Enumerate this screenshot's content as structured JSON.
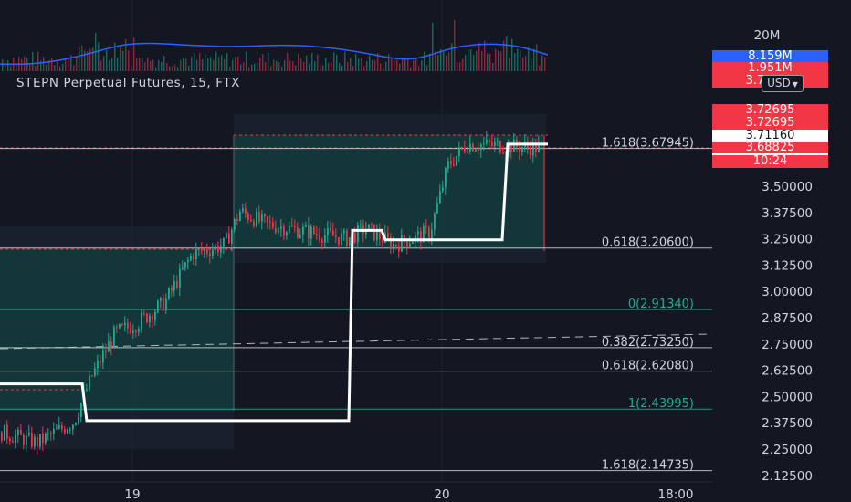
{
  "symbol_title": "STEPN Perpetual Futures, 15, FTX",
  "currency_button": "USD",
  "volume_axis_label": "20M",
  "price_tags": [
    {
      "text": "8.159M",
      "bg": "#2962ff",
      "fg": "#ffffff"
    },
    {
      "text": "1.951M",
      "bg": "#f23645",
      "fg": "#ffffff"
    },
    {
      "text": "3.72695",
      "bg": "#f23645",
      "fg": "#ffffff"
    },
    {
      "text": "3.72695",
      "bg": "#f23645",
      "fg": "#ffffff"
    },
    {
      "text": "3.72695",
      "bg": "#f23645",
      "fg": "#ffffff"
    },
    {
      "text": "3.71160",
      "bg": "#ffffff",
      "fg": "#131722"
    },
    {
      "text": "3.68825",
      "bg": "#ffffff",
      "fg": "#131722"
    },
    {
      "text": "3.68825",
      "bg": "#f23645",
      "fg": "#ffffff"
    },
    {
      "text": "10:24",
      "bg": "#f23645",
      "fg": "#ffffff"
    }
  ],
  "chart_data": {
    "type": "candlestick",
    "symbol": "STEPN Perpetual Futures",
    "interval": "15",
    "exchange": "FTX",
    "y_axis_labels": [
      "3.50000",
      "3.37500",
      "3.25000",
      "3.12500",
      "3.00000",
      "2.87500",
      "2.75000",
      "2.62500",
      "2.50000",
      "2.37500",
      "2.25000",
      "2.12500"
    ],
    "x_axis_labels": [
      "19",
      "20",
      "18:00"
    ],
    "ylim": [
      2.1,
      3.8
    ],
    "fib_levels": [
      {
        "label": "1.618(3.67945)",
        "value": 3.67945,
        "color": "#d1d4dc"
      },
      {
        "label": "0.618(3.20600)",
        "value": 3.206,
        "color": "#d1d4dc"
      },
      {
        "label": "0(2.91340)",
        "value": 2.9134,
        "color": "#22ab94"
      },
      {
        "label": "0.382(2.73250)",
        "value": 2.7325,
        "color": "#d1d4dc"
      },
      {
        "label": "0.618(2.62080)",
        "value": 2.6208,
        "color": "#d1d4dc"
      },
      {
        "label": "1(2.43995)",
        "value": 2.43995,
        "color": "#22ab94"
      },
      {
        "label": "1.618(2.14735)",
        "value": 2.14735,
        "color": "#d1d4dc"
      }
    ],
    "step_line": [
      {
        "x": 0,
        "y": 2.56
      },
      {
        "x": 90,
        "y": 2.56
      },
      {
        "x": 95,
        "y": 2.385
      },
      {
        "x": 382,
        "y": 2.385
      },
      {
        "x": 386,
        "y": 3.29
      },
      {
        "x": 418,
        "y": 3.29
      },
      {
        "x": 422,
        "y": 3.245
      },
      {
        "x": 550,
        "y": 3.245
      },
      {
        "x": 556,
        "y": 3.7
      },
      {
        "x": 600,
        "y": 3.7
      }
    ]
  }
}
